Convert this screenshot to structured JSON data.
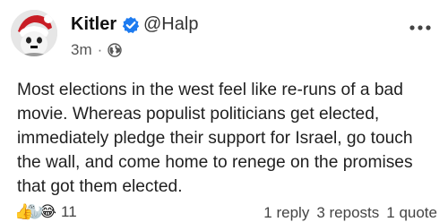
{
  "post": {
    "author": {
      "name": "Kitler",
      "handle": "@Halp",
      "verified": true
    },
    "time": "3m",
    "visibility_icon": "globe-icon",
    "body": "Most elections in the west feel like re-runs of a bad movie. Whereas populist politicians get elected, immediately pledge their support for Israel, go touch the wall, and come home to renege on the promises that got them elected.",
    "reactions": {
      "icons": [
        "thumbs-up-icon",
        "seal-emoji-icon",
        "crying-laughing-icon"
      ],
      "count": "11"
    },
    "stats": {
      "replies": "1 reply",
      "reposts": "3 reposts",
      "quotes": "1 quote"
    }
  },
  "colors": {
    "verified_badge": "#1d7bf0",
    "text": "#1f1f1f",
    "muted": "#555555"
  }
}
